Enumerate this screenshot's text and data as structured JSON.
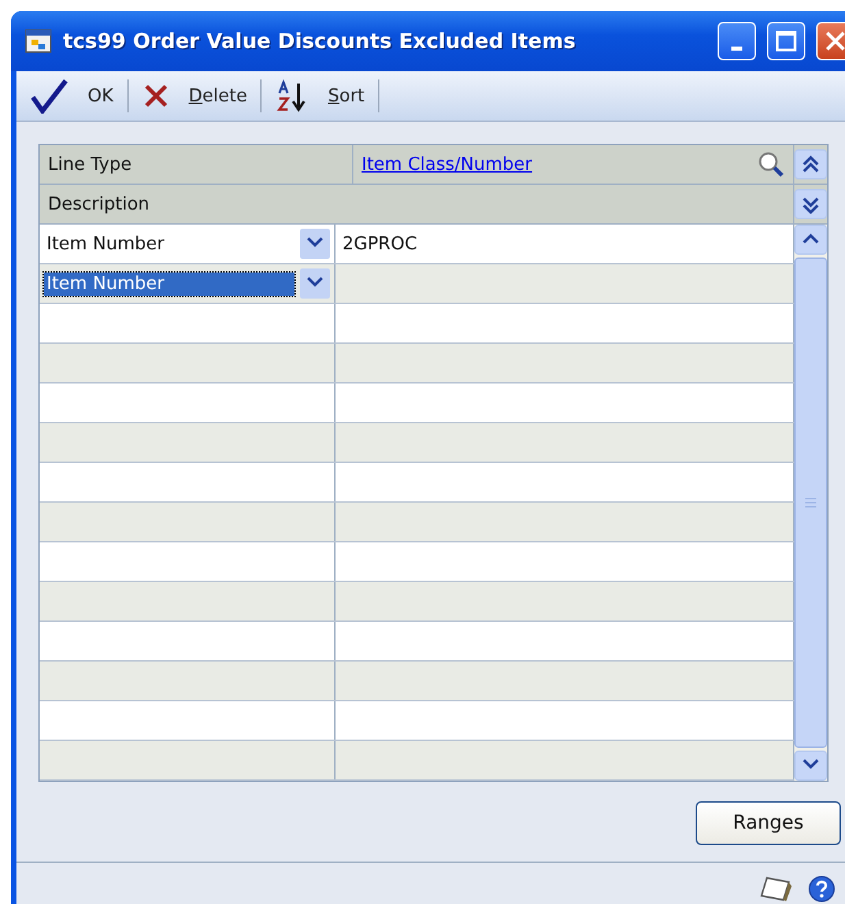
{
  "window": {
    "title": "tcs99 Order Value Discounts Excluded Items"
  },
  "toolbar": [
    {
      "kind": "ok",
      "label": "OK"
    },
    {
      "kind": "delete",
      "label": "Delete"
    },
    {
      "kind": "sort",
      "label": "Sort"
    }
  ],
  "grid": {
    "columns": [
      {
        "label": "Line Type",
        "link": false
      },
      {
        "label": "Item Class/Number",
        "link": true
      }
    ],
    "second_header": "Description",
    "rows": [
      {
        "line_type": "Item Number",
        "item": "2GPROC",
        "selected": false
      },
      {
        "line_type": "Item Number",
        "selected": true
      }
    ]
  },
  "buttons": [
    {
      "label": "Ranges"
    }
  ]
}
